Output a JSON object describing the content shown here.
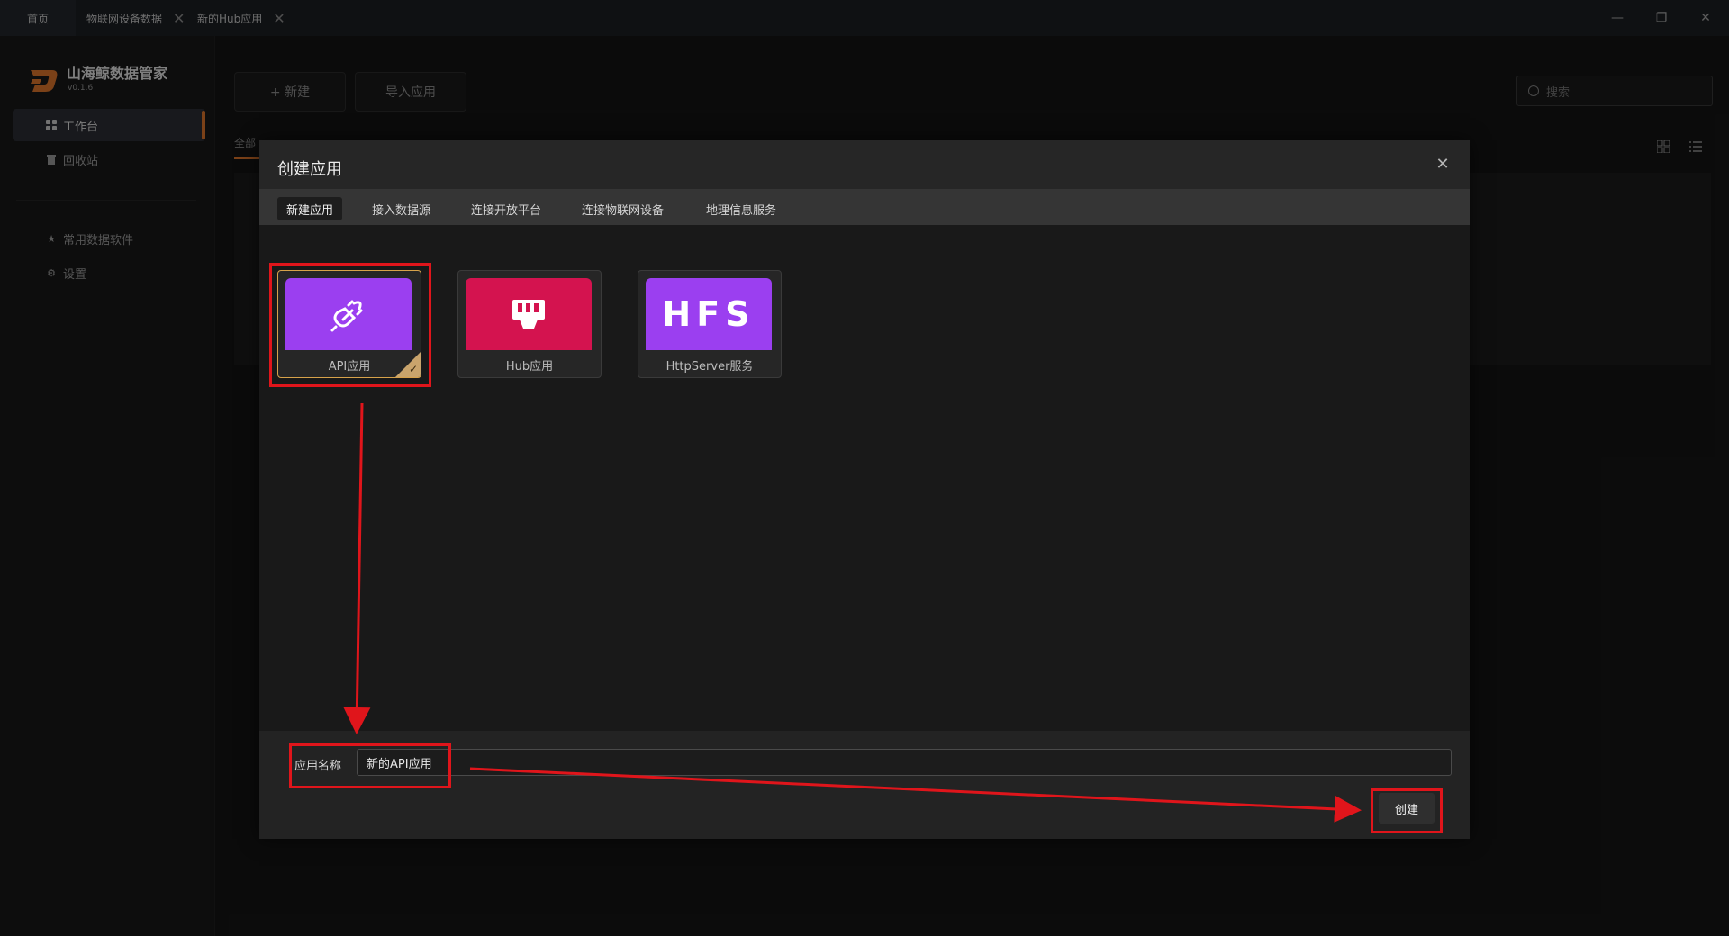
{
  "titlebar": {
    "tabs": [
      {
        "label": "首页"
      },
      {
        "label": "物联网设备数据",
        "close": "✕"
      },
      {
        "label": "新的Hub应用",
        "close": "✕"
      }
    ],
    "window_controls": {
      "minimize": "—",
      "restore": "❐",
      "close": "✕"
    }
  },
  "sidebar": {
    "app_name": "山海鲸数据管家",
    "version": "v0.1.6",
    "items": [
      {
        "label": "工作台",
        "icon": "grid-icon",
        "active": true
      },
      {
        "label": "回收站",
        "icon": "trash-icon"
      },
      {
        "label": "常用数据软件",
        "icon": "star-icon"
      },
      {
        "label": "设置",
        "icon": "gear-icon"
      }
    ]
  },
  "background": {
    "new_button": "+ 新建",
    "import_button": "导入应用",
    "search_placeholder": "搜索",
    "filter_tab": "全部"
  },
  "modal": {
    "title": "创建应用",
    "close": "✕",
    "tabs": [
      {
        "label": "新建应用",
        "active": true
      },
      {
        "label": "接入数据源"
      },
      {
        "label": "连接开放平台"
      },
      {
        "label": "连接物联网设备"
      },
      {
        "label": "地理信息服务"
      }
    ],
    "cards": [
      {
        "label": "API应用",
        "icon": "plug-icon",
        "color": "#9b3ff0",
        "selected": true
      },
      {
        "label": "Hub应用",
        "icon": "hub-icon",
        "color": "#d4134f"
      },
      {
        "label": "HttpServer服务",
        "icon_text": "HFS",
        "color": "#9b3ff0"
      }
    ],
    "name_label": "应用名称",
    "name_value": "新的API应用",
    "create_button": "创建"
  },
  "colors": {
    "accent": "#e0772c",
    "annotation": "#e0151b",
    "selected_border": "#d7a24a"
  }
}
